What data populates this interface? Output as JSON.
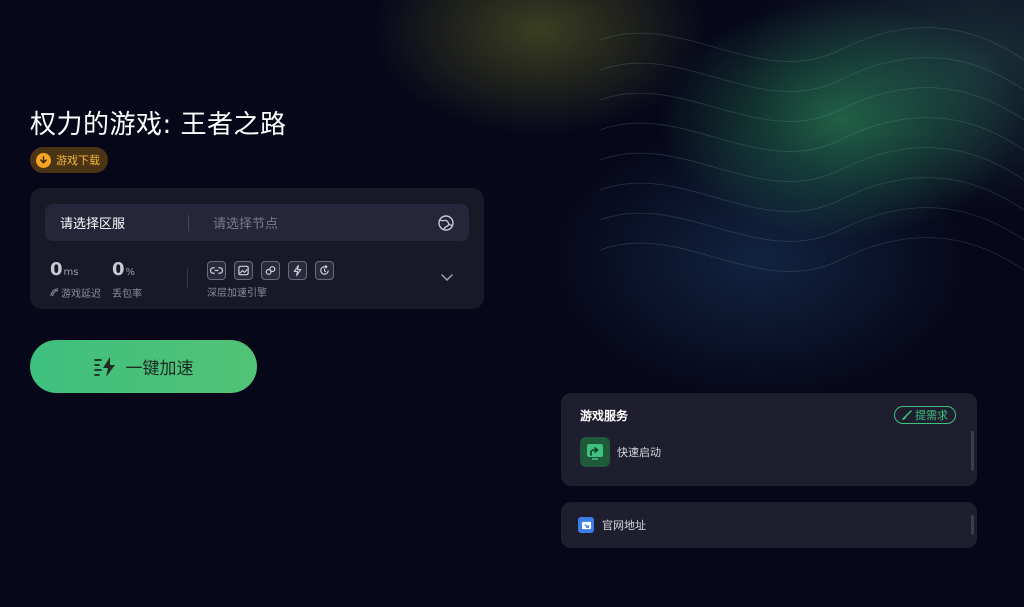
{
  "game": {
    "title": "权力的游戏: 王者之路",
    "download_label": "游戏下载"
  },
  "selector": {
    "region_label": "请选择区服",
    "node_placeholder": "请选择节点"
  },
  "stats": {
    "latency_value": "0",
    "latency_unit": "ms",
    "latency_label": "游戏延迟",
    "loss_value": "0",
    "loss_unit": "%",
    "loss_label": "丢包率",
    "engine_label": "深层加速引擎",
    "engine_icons": [
      "link-icon",
      "image-icon",
      "chain-icon",
      "bolt-icon",
      "refresh-icon"
    ]
  },
  "accelerate": {
    "label": "一键加速"
  },
  "services": {
    "title": "游戏服务",
    "request_label": "提需求",
    "quick_start_label": "快速启动",
    "website_label": "官网地址"
  },
  "colors": {
    "accent_green": "#3ec07e",
    "download_orange": "#f5a623",
    "background": "#07071a",
    "card": "#1e1e2e"
  }
}
